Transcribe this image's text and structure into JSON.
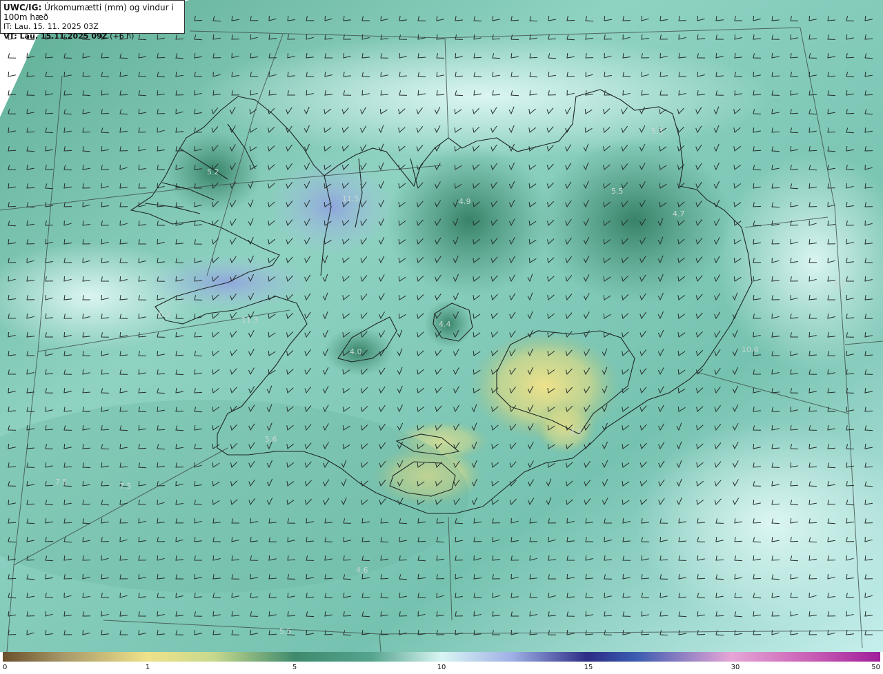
{
  "header": {
    "model": "UWC/IG:",
    "title": "Úrkomumætti (mm) og vindur i 100m hæð",
    "init_time": "IT: Lau. 15. 11. 2025 03Z",
    "valid_time": "VT: Lau. 15.11.2025 09Z",
    "lead": "(+6 h)"
  },
  "value_labels": [
    "5.2",
    "11.5",
    "4.9",
    "5.5",
    "4.7",
    "5.3",
    "4.4",
    "4.0",
    "10.8",
    "6.2",
    "11.3",
    "5.6",
    "7.5",
    "7.5",
    "4.6",
    "5.5",
    "4.3",
    "8.2"
  ],
  "colorbar": {
    "ticks": [
      "0",
      "1",
      "5",
      "10",
      "15",
      "30",
      "50"
    ]
  },
  "colors": {
    "land_green": "#3f8a6e",
    "sea_cyan": "#bfe9e6",
    "precip_yellow": "#e8df8c",
    "precip_blue": "#8fa6dc"
  }
}
